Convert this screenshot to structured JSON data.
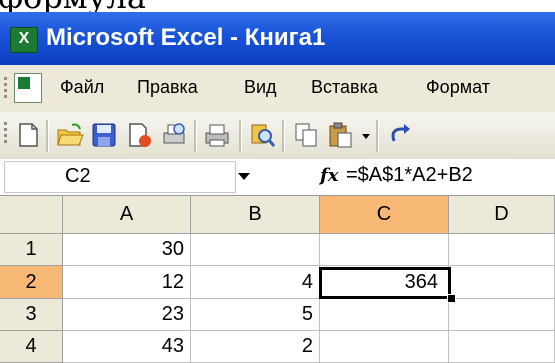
{
  "caption": "формула",
  "window": {
    "title": "Microsoft Excel - Книга1",
    "icon": "excel-app-icon"
  },
  "menu": {
    "items": [
      "Файл",
      "Правка",
      "Вид",
      "Вставка",
      "Формат"
    ]
  },
  "toolbar": {
    "icons": [
      "new-icon",
      "open-icon",
      "save-icon",
      "permission-icon",
      "print-preview-icon",
      "print-icon",
      "research-icon",
      "copy-icon",
      "paste-icon",
      "undo-icon"
    ]
  },
  "formula_bar": {
    "name_box": "C2",
    "fx_label": "fx",
    "formula": "=$A$1*A2+B2"
  },
  "grid": {
    "columns": [
      "A",
      "B",
      "C",
      "D"
    ],
    "rows": [
      "1",
      "2",
      "3",
      "4"
    ],
    "cells": [
      [
        "30",
        "",
        "",
        ""
      ],
      [
        "12",
        "4",
        "364",
        ""
      ],
      [
        "23",
        "5",
        "",
        ""
      ],
      [
        "43",
        "2",
        "",
        ""
      ]
    ],
    "selected_cell": "C2"
  },
  "colors": {
    "title_bar": "#1b56d8",
    "selected_header": "#f7b876",
    "chrome": "#ece9d8"
  }
}
